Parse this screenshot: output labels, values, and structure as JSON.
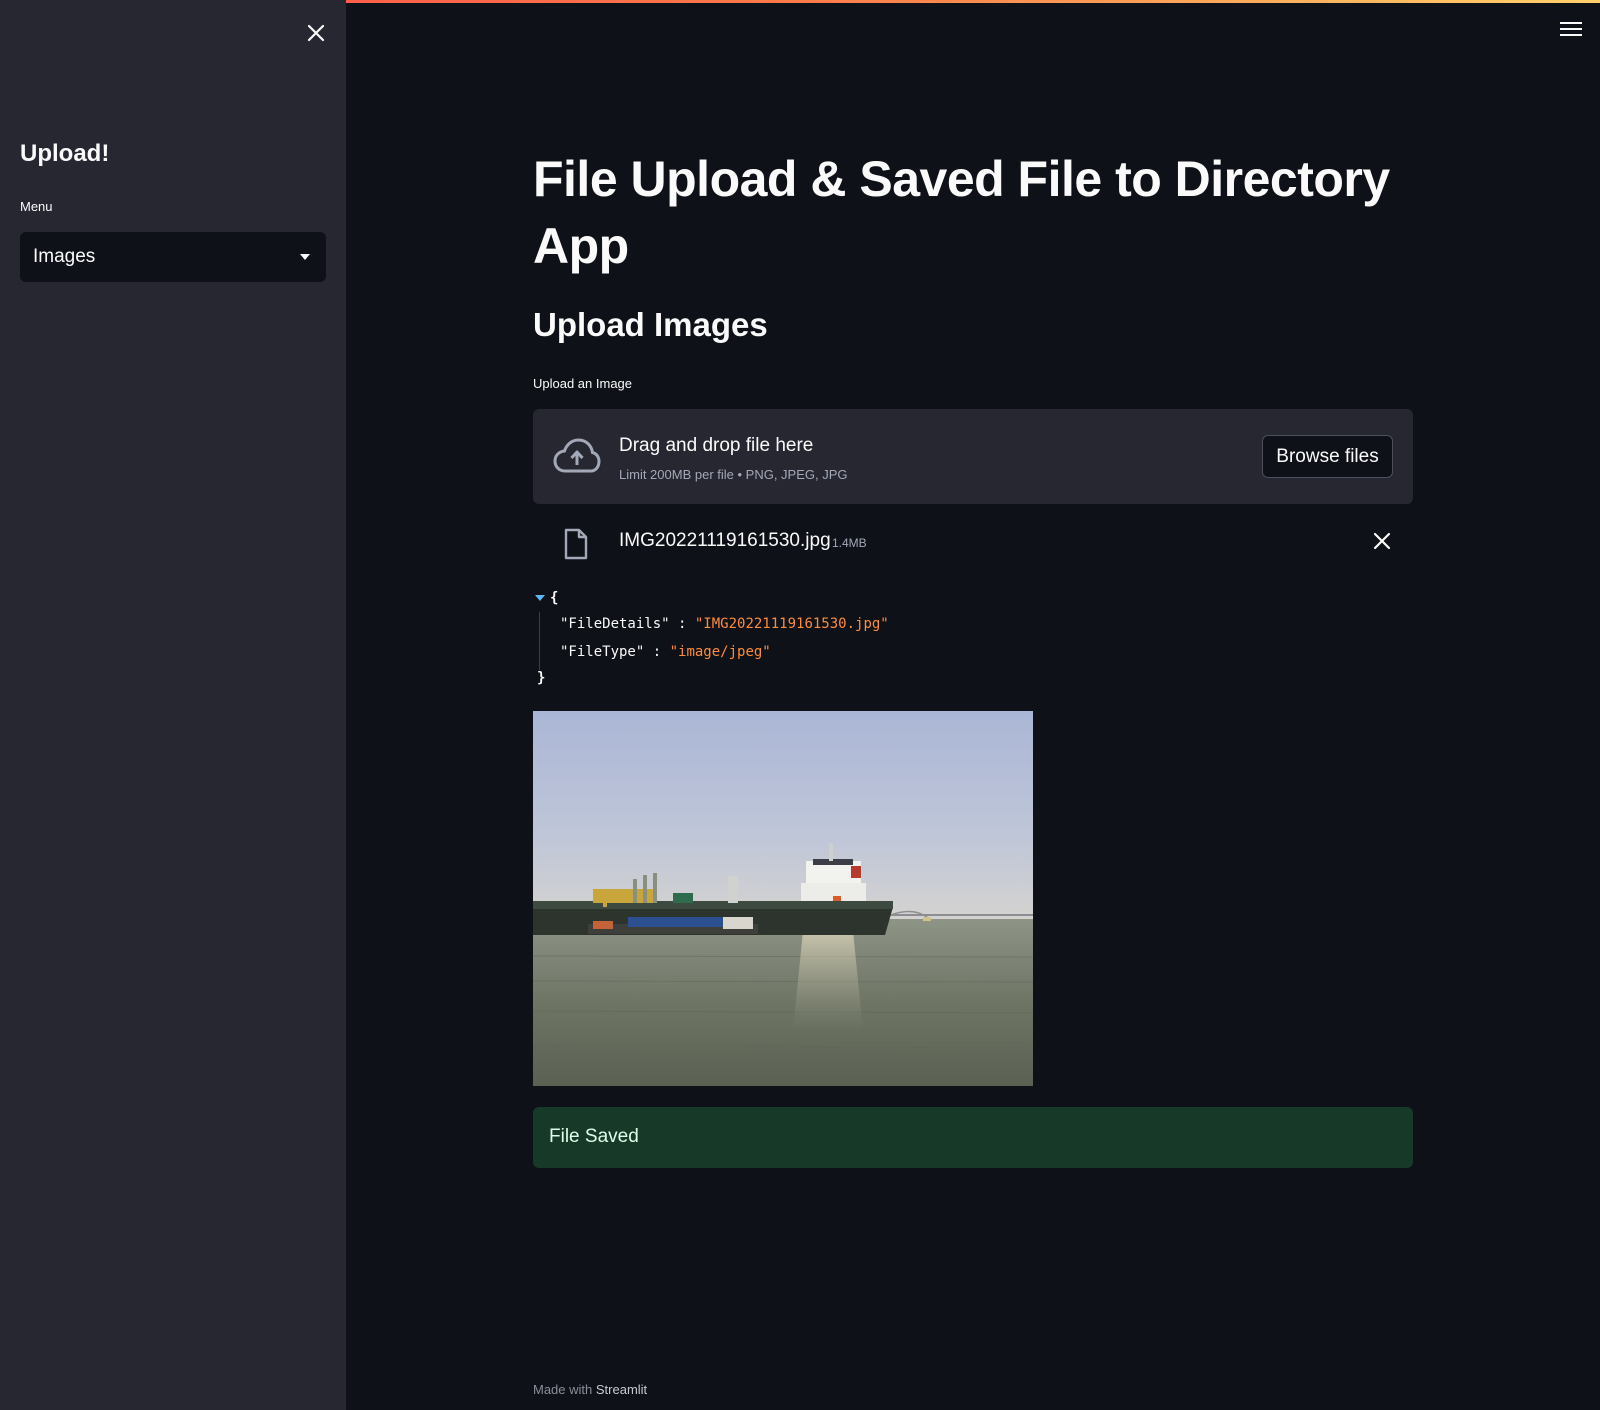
{
  "sidebar": {
    "title": "Upload!",
    "menu_label": "Menu",
    "menu_selected": "Images"
  },
  "main": {
    "title": "File Upload & Saved File to Directory App",
    "subheader": "Upload Images",
    "uploader": {
      "label": "Upload an Image",
      "drag_text": "Drag and drop file here",
      "limit_text": "Limit 200MB per file • PNG, JPEG, JPG",
      "browse_label": "Browse files"
    },
    "uploaded_file": {
      "name": "IMG20221119161530.jpg",
      "size": "1.4MB"
    },
    "json_view": {
      "open_brace": "{",
      "close_brace": "}",
      "entries": [
        {
          "key": "\"FileDetails\"",
          "value": "\"IMG20221119161530.jpg\""
        },
        {
          "key": "\"FileType\"",
          "value": "\"image/jpeg\""
        }
      ]
    },
    "success_message": "File Saved"
  },
  "footer": {
    "prefix": "Made with",
    "brand": "Streamlit"
  },
  "icons": {
    "sidebar_close": "close-icon",
    "main_menu": "hamburger-menu-icon",
    "upload": "cloud-upload-icon",
    "file": "file-icon",
    "remove_file": "close-icon"
  },
  "colors": {
    "background": "#0e1117",
    "sidebar": "#262730",
    "success_bg": "#173928",
    "json_string": "#ff8c3a",
    "accent_red": "#ff4b4b"
  }
}
